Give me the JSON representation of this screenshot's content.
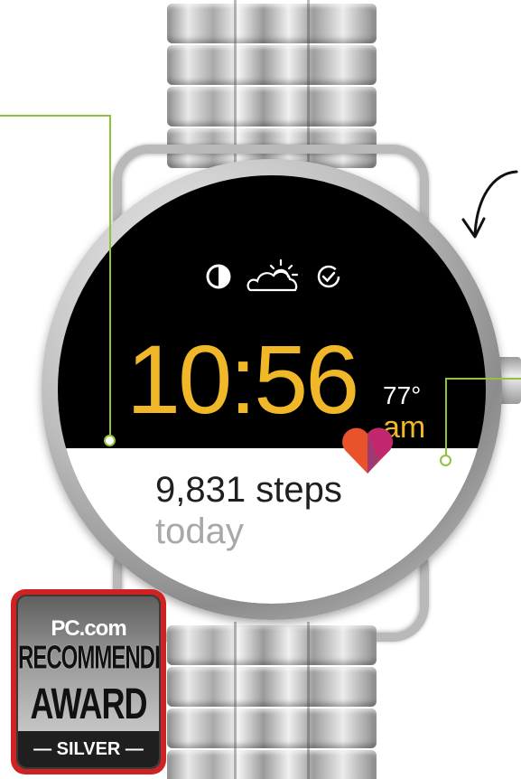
{
  "watch_face": {
    "time": "10:56",
    "meridiem": "am",
    "temperature": "77°",
    "steps": "9,831 steps",
    "steps_period": "today",
    "status_icons": [
      "moon-phase-icon",
      "partly-cloudy-icon",
      "check-circle-icon"
    ],
    "time_color": "#f0b829"
  },
  "badge": {
    "site": "PC.com",
    "line1": "RECOMMENDED",
    "line2": "AWARD",
    "tier": "— SILVER —",
    "border_color": "#cf2222"
  },
  "callout_color": "#8fc43a",
  "icons": [
    "heart-icon",
    "curved-arrow-icon"
  ]
}
